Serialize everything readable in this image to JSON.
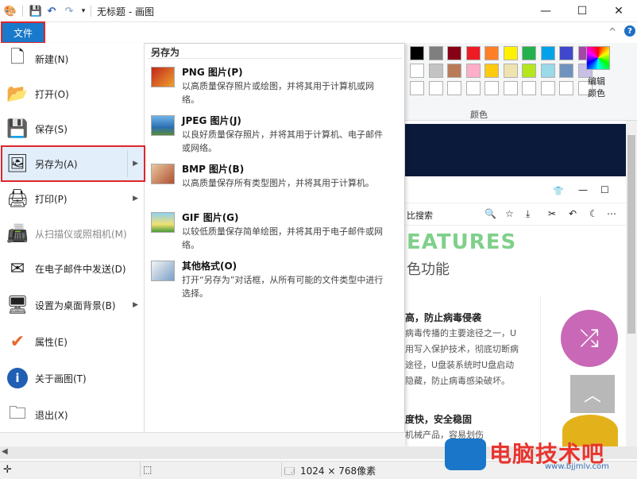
{
  "window": {
    "title": "无标题 - 画图",
    "minimize": "—",
    "maximize": "☐",
    "close": "✕"
  },
  "quick_access": {
    "app_icon": "paint-palette-icon",
    "save_icon": "save-icon",
    "undo_icon": "undo-icon",
    "redo_icon": "redo-icon",
    "customize_icon": "dropdown-icon"
  },
  "ribbon": {
    "file_tab": "文件",
    "colors_label": "颜色",
    "edit_colors_label": "编辑颜色",
    "help": "?",
    "collapse": "^",
    "palette_row1": [
      "#000000",
      "#7f7f7f",
      "#880015",
      "#ed1c24",
      "#ff7f27",
      "#fff200",
      "#22b14c",
      "#00a2e8",
      "#3f48cc",
      "#a349a4"
    ],
    "palette_row2": [
      "#ffffff",
      "#c3c3c3",
      "#b97a57",
      "#ffaec9",
      "#ffc90e",
      "#efe4b0",
      "#b5e61d",
      "#99d9ea",
      "#7092be",
      "#c8bfe7"
    ],
    "palette_row3": [
      "#ffffff",
      "#ffffff",
      "#ffffff",
      "#ffffff",
      "#ffffff",
      "#ffffff",
      "#ffffff",
      "#ffffff",
      "#ffffff",
      "#ffffff"
    ]
  },
  "file_menu": {
    "items": [
      {
        "label": "新建(N)",
        "icon": "new-file-icon"
      },
      {
        "label": "打开(O)",
        "icon": "open-folder-icon"
      },
      {
        "label": "保存(S)",
        "icon": "save-icon"
      },
      {
        "label": "另存为(A)",
        "icon": "save-as-icon"
      },
      {
        "label": "打印(P)",
        "icon": "printer-icon"
      },
      {
        "label": "从扫描仪或照相机(M)",
        "icon": "scanner-icon"
      },
      {
        "label": "在电子邮件中发送(D)",
        "icon": "email-icon"
      },
      {
        "label": "设置为桌面背景(B)",
        "icon": "desktop-background-icon"
      },
      {
        "label": "属性(E)",
        "icon": "checkmark-icon"
      },
      {
        "label": "关于画图(T)",
        "icon": "info-icon"
      },
      {
        "label": "退出(X)",
        "icon": "exit-icon"
      }
    ],
    "submenu": {
      "title": "另存为",
      "items": [
        {
          "title": "PNG 图片(P)",
          "desc": "以高质量保存照片或绘图，并将其用于计算机或网络。",
          "icon": "png-image-icon"
        },
        {
          "title": "JPEG 图片(J)",
          "desc": "以良好质量保存照片，并将其用于计算机、电子邮件或网络。",
          "icon": "jpeg-image-icon"
        },
        {
          "title": "BMP 图片(B)",
          "desc": "以高质量保存所有类型图片，并将其用于计算机。",
          "icon": "bmp-image-icon"
        },
        {
          "title": "GIF 图片(G)",
          "desc": "以较低质量保存简单绘图，并将其用于电子邮件或网络。",
          "icon": "gif-image-icon"
        },
        {
          "title": "其他格式(O)",
          "desc": "打开“另存为”对话框，从所有可能的文件类型中进行选择。",
          "icon": "other-formats-icon"
        }
      ]
    }
  },
  "canvas_content": {
    "search_text": "比搜索",
    "features": "EATURES",
    "function_text": "色功能",
    "article_title1": "高，防止病毒侵袭",
    "article_lines": [
      "病毒传播的主要途径之一，U",
      "用写入保护技术，彻底切断病",
      "途径，U盘装系统时U盘启动",
      "隐藏，防止病毒感染破坏。"
    ],
    "article_title2": "度快，安全稳固",
    "article_line2": "机械产品，容易划伤"
  },
  "status_bar": {
    "image_size": "1024 × 768像素"
  },
  "watermark": {
    "brand": "电脑技术吧",
    "url": "www.bjjmlv.com"
  }
}
